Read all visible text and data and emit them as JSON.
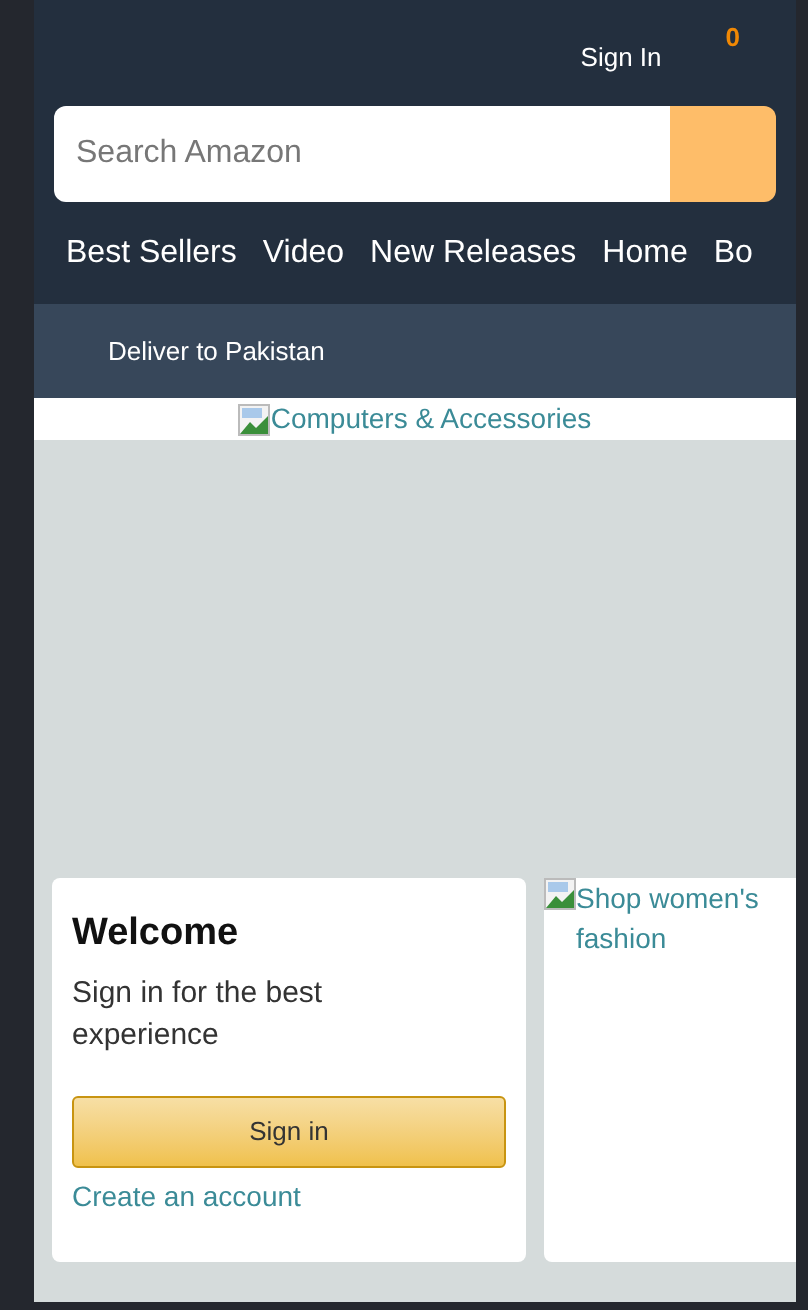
{
  "header": {
    "sign_in": "Sign In",
    "cart_count": "0"
  },
  "search": {
    "placeholder": "Search Amazon"
  },
  "nav_links": [
    "Best Sellers",
    "Video",
    "New Releases",
    "Home",
    "Bo"
  ],
  "deliver": "Deliver to Pakistan",
  "hero": {
    "alt_text": "Computers & Accessories"
  },
  "welcome_card": {
    "title": "Welcome",
    "text": "Sign in for the best experience",
    "button": "Sign in",
    "link": "Create an account"
  },
  "promo_card": {
    "alt_text": "Shop women's fashion"
  }
}
